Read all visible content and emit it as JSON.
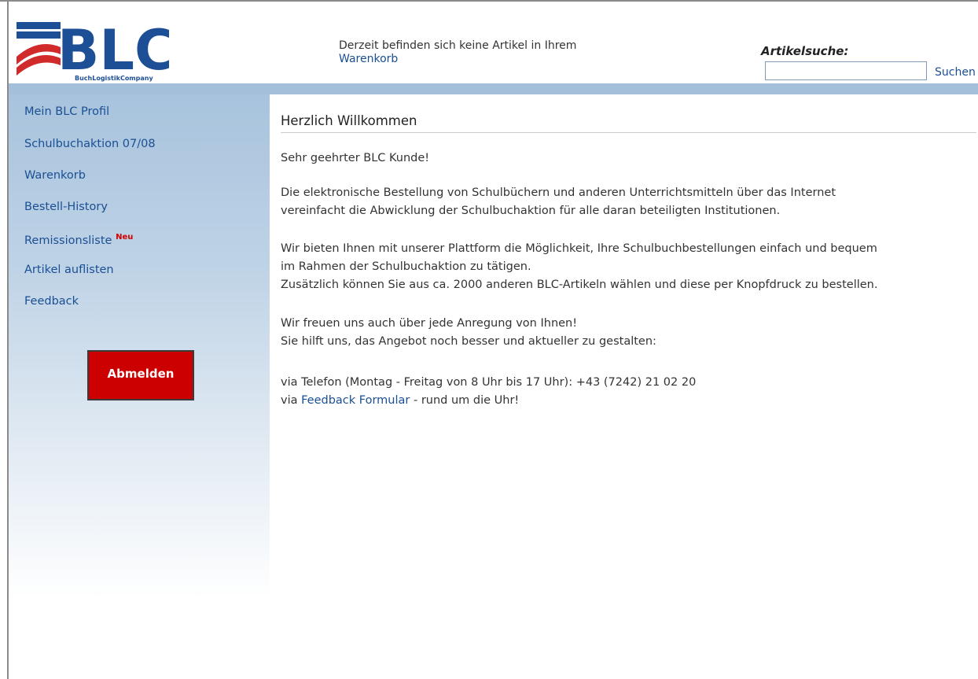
{
  "logo": {
    "text": "BLC",
    "subtext": "BuchLogistikCompany"
  },
  "cart": {
    "message": "Derzeit befinden sich keine Artikel in Ihrem",
    "link": "Warenkorb"
  },
  "search": {
    "label": "Artikelsuche:",
    "value": "",
    "button": "Suchen"
  },
  "nav": {
    "items": [
      {
        "label": "Mein BLC Profil"
      },
      {
        "label": "Schulbuchaktion 07/08"
      },
      {
        "label": "Warenkorb"
      },
      {
        "label": "Bestell-History"
      },
      {
        "label": "Remissionsliste",
        "badge": "Neu"
      },
      {
        "label": "Artikel auflisten"
      },
      {
        "label": "Feedback"
      }
    ],
    "logout": "Abmelden"
  },
  "content": {
    "title": "Herzlich Willkommen",
    "greeting": "Sehr geehrter BLC Kunde!",
    "p1_line1": "Die elektronische Bestellung von Schulbüchern und anderen Unterrichtsmitteln über das Internet",
    "p1_line2": "vereinfacht die Abwicklung der Schulbuchaktion für alle daran beteiligten Institutionen.",
    "p2_line1": "Wir bieten Ihnen mit unserer Plattform die Möglichkeit, Ihre Schulbuchbestellungen einfach und bequem",
    "p2_line2": "im Rahmen der Schulbuchaktion zu tätigen.",
    "p2_line3": "Zusätzlich können Sie aus ca. 2000 anderen BLC-Artikeln wählen und diese per Knopfdruck zu bestellen.",
    "p3_line1": "Wir freuen uns auch über jede Anregung von Ihnen!",
    "p3_line2": "Sie hilft uns, das Angebot noch besser und aktueller zu gestalten:",
    "contact_phone": "via Telefon (Montag - Freitag von 8 Uhr bis 17 Uhr): +43 (7242) 21 02 20",
    "contact_prefix": "via",
    "contact_link": "Feedback Formular",
    "contact_suffix": "- rund um die Uhr!"
  },
  "colors": {
    "link": "#1a4f94",
    "logout_bg": "#cc0000",
    "badge": "#d40000",
    "logo_blue": "#1d4f96",
    "logo_red": "#d02a2a"
  }
}
